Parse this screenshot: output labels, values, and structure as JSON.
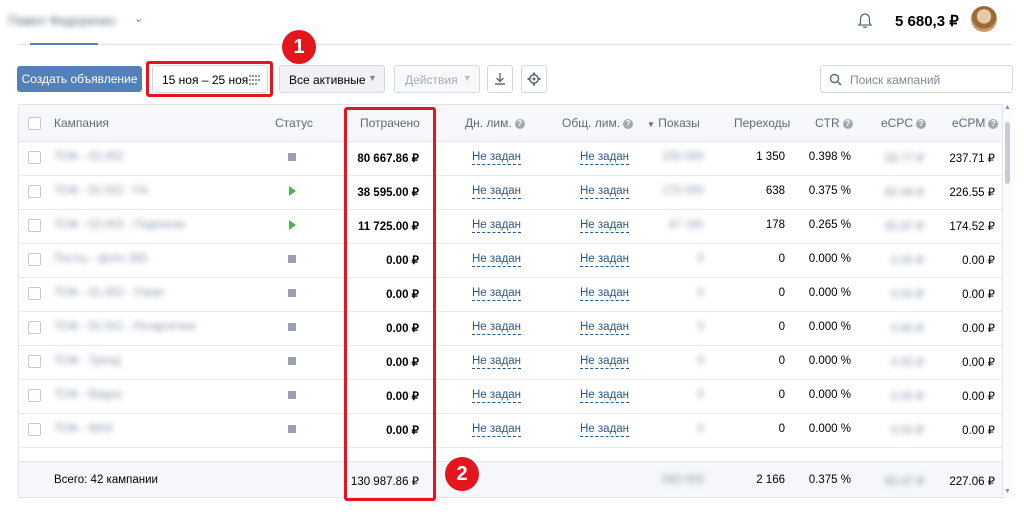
{
  "header": {
    "account_name": "Павел Федоренко",
    "balance": "5 680,3 ₽"
  },
  "toolbar": {
    "create_label": "Создать объявление",
    "date_range": "15 ноя – 25 ноя",
    "filter_value": "Все активные",
    "actions_label": "Действия",
    "search_placeholder": "Поиск кампаний"
  },
  "table": {
    "columns": {
      "campaign": "Кампания",
      "status": "Статус",
      "spent": "Потрачено",
      "daily_limit": "Дн. лим.",
      "total_limit": "Общ. лим.",
      "impressions": "Показы",
      "clicks": "Переходы",
      "ctr": "CTR",
      "ecpc": "eCPC",
      "ecpm": "eCPM"
    },
    "rows": [
      {
        "name": "ТОФ - 02.002",
        "status": "paused",
        "spent": "80 667.86 ₽",
        "daily": "Не задан",
        "total": "Не задан",
        "impressions": "200 000",
        "clicks": "1 350",
        "ctr": "0.398 %",
        "ecpc": "59.77 ₽",
        "ecpm": "237.71 ₽"
      },
      {
        "name": "ТОФ - 02.002 - FA",
        "status": "active",
        "spent": "38 595.00 ₽",
        "daily": "Не задан",
        "total": "Не задан",
        "impressions": "170 000",
        "clicks": "638",
        "ctr": "0.375 %",
        "ecpc": "60.49 ₽",
        "ecpm": "226.55 ₽"
      },
      {
        "name": "ТОФ - 02.003 - Подписки",
        "status": "active",
        "spent": "11 725.00 ₽",
        "daily": "Не задан",
        "total": "Не задан",
        "impressions": "67 181",
        "clicks": "178",
        "ctr": "0.265 %",
        "ecpc": "65.87 ₽",
        "ecpm": "174.52 ₽"
      },
      {
        "name": "Посты - фото 365",
        "status": "paused",
        "spent": "0.00 ₽",
        "daily": "Не задан",
        "total": "Не задан",
        "impressions": "0",
        "clicks": "0",
        "ctr": "0.000 %",
        "ecpc": "0.00 ₽",
        "ecpm": "0.00 ₽"
      },
      {
        "name": "ТОФ - 01.002 - Узкая",
        "status": "paused",
        "spent": "0.00 ₽",
        "daily": "Не задан",
        "total": "Не задан",
        "impressions": "0",
        "clicks": "0",
        "ctr": "0.000 %",
        "ecpc": "0.00 ₽",
        "ecpm": "0.00 ₽"
      },
      {
        "name": "ТОФ - 02.001 - Ретаргетинг",
        "status": "paused",
        "spent": "0.00 ₽",
        "daily": "Не задан",
        "total": "Не задан",
        "impressions": "0",
        "clicks": "0",
        "ctr": "0.000 %",
        "ecpc": "0.00 ₽",
        "ecpm": "0.00 ₽"
      },
      {
        "name": "ТОФ - Тренд",
        "status": "paused",
        "spent": "0.00 ₽",
        "daily": "Не задан",
        "total": "Не задан",
        "impressions": "0",
        "clicks": "0",
        "ctr": "0.000 %",
        "ecpc": "0.00 ₽",
        "ecpm": "0.00 ₽"
      },
      {
        "name": "ТОФ - Видео",
        "status": "paused",
        "spent": "0.00 ₽",
        "daily": "Не задан",
        "total": "Не задан",
        "impressions": "0",
        "clicks": "0",
        "ctr": "0.000 %",
        "ecpc": "0.00 ₽",
        "ecpm": "0.00 ₽"
      },
      {
        "name": "ТОФ - МАХ",
        "status": "paused",
        "spent": "0.00 ₽",
        "daily": "Не задан",
        "total": "Не задан",
        "impressions": "0",
        "clicks": "0",
        "ctr": "0.000 %",
        "ecpc": "0.00 ₽",
        "ecpm": "0.00 ₽"
      }
    ],
    "footer": {
      "label": "Всего: 42 кампании",
      "spent": "130 987.86 ₽",
      "impressions": "580 000",
      "clicks": "2 166",
      "ctr": "0.375 %",
      "ecpc": "60.47 ₽",
      "ecpm": "227.06 ₽"
    }
  },
  "annotations": {
    "badge1": "1",
    "badge2": "2",
    "color": "#e3161d"
  },
  "colors": {
    "accent": "#5181b8",
    "link": "#2a5885",
    "status_active": "#4bb34b",
    "status_paused": "#9aa3ad"
  }
}
